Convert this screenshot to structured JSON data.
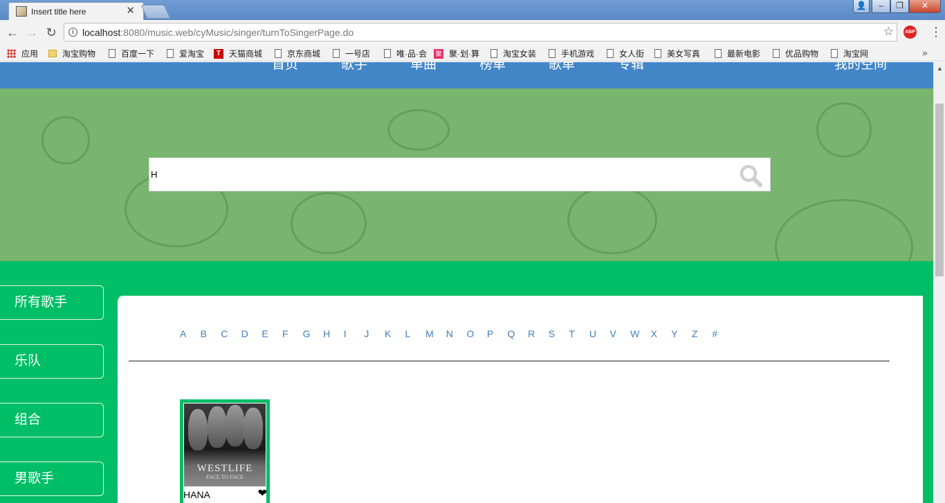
{
  "browser": {
    "tab_title": "Insert title here",
    "url_host": "localhost",
    "url_rest": ":8080/music.web/cyMusic/singer/turnToSingerPage.do",
    "abp_label": "ABP"
  },
  "bookmarks": [
    {
      "label": "应用",
      "icon": "apps-icon"
    },
    {
      "label": "淘宝购物",
      "icon": "folder-icon"
    },
    {
      "label": "百度一下",
      "icon": "page-icon"
    },
    {
      "label": "爱淘宝",
      "icon": "page-icon"
    },
    {
      "label": "天猫商城",
      "icon": "tmall-icon"
    },
    {
      "label": "京东商城",
      "icon": "page-icon"
    },
    {
      "label": "一号店",
      "icon": "page-icon"
    },
    {
      "label": "唯·品·会",
      "icon": "page-icon"
    },
    {
      "label": "聚·划·算",
      "icon": "juhuasuan-icon"
    },
    {
      "label": "淘宝女装",
      "icon": "page-icon"
    },
    {
      "label": "手机游戏",
      "icon": "page-icon"
    },
    {
      "label": "女人街",
      "icon": "page-icon"
    },
    {
      "label": "美女写真",
      "icon": "page-icon"
    },
    {
      "label": "最新电影",
      "icon": "page-icon"
    },
    {
      "label": "优品购物",
      "icon": "page-icon"
    },
    {
      "label": "淘宝网",
      "icon": "page-icon"
    }
  ],
  "nav": {
    "items": [
      "首页",
      "歌手",
      "单曲",
      "榜单",
      "歌单",
      "专辑"
    ],
    "right": "我的空间"
  },
  "search": {
    "value": "H"
  },
  "sidebar": {
    "items": [
      "所有歌手",
      "乐队",
      "组合",
      "男歌手"
    ]
  },
  "letters": [
    "A",
    "B",
    "C",
    "D",
    "E",
    "F",
    "G",
    "H",
    "I",
    "J",
    "K",
    "L",
    "M",
    "N",
    "O",
    "P",
    "Q",
    "R",
    "S",
    "T",
    "U",
    "V",
    "W",
    "X",
    "Y",
    "Z",
    "#"
  ],
  "singer_card": {
    "name": "HANA",
    "cover_title": "WESTLIFE",
    "cover_subtitle": "FACE TO FACE"
  },
  "colors": {
    "nav_bg": "#4286c8",
    "banner_bg": "#78b56f",
    "page_bg": "#00be66",
    "letter_link": "#3f7ebd"
  }
}
